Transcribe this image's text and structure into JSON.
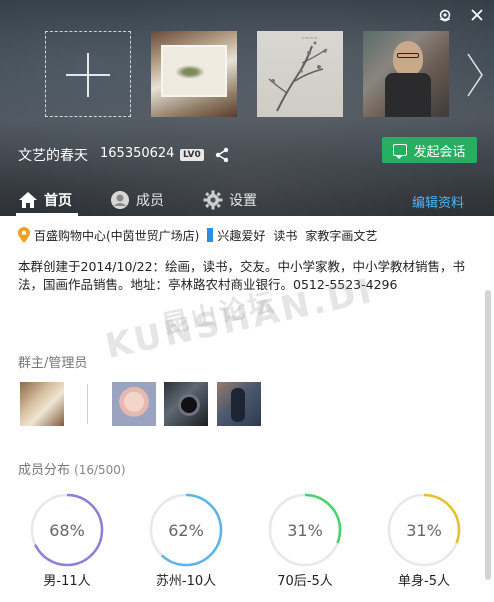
{
  "window": {
    "settings_icon": "settings-icon",
    "close_icon": "close-icon"
  },
  "header": {
    "group_name": "文艺的春天",
    "group_id": "165350624",
    "level": "LV0",
    "start_chat_label": "发起会话"
  },
  "tabs": {
    "home": "首页",
    "members": "成员",
    "settings": "设置",
    "edit_link": "编辑资料"
  },
  "location": {
    "place": "百盛购物中心(中茵世贸广场店)",
    "tag_prefix": "兴趣爱好",
    "tags": [
      "读书",
      "家教字画文艺"
    ]
  },
  "description": "本群创建于2014/10/22：绘画，读书，交友。中小学家教，中小学教材销售，书法，国画作品销售。地址：亭林路农村商业银行。0512-5523-4296",
  "watermark": {
    "en": "KUNSHAN.DI",
    "cn": "昆山论坛"
  },
  "admins": {
    "title": "群主/管理员"
  },
  "distribution": {
    "title": "成员分布",
    "count": "(16/500)",
    "items": [
      {
        "pct": "68%",
        "label": "男-11人",
        "value": 0.68,
        "color": "#8f7ed8"
      },
      {
        "pct": "62%",
        "label": "苏州-10人",
        "value": 0.62,
        "color": "#5ab4e8"
      },
      {
        "pct": "31%",
        "label": "70后-5人",
        "value": 0.31,
        "color": "#4cd06a"
      },
      {
        "pct": "31%",
        "label": "单身-5人",
        "value": 0.31,
        "color": "#e6c02c"
      }
    ]
  }
}
